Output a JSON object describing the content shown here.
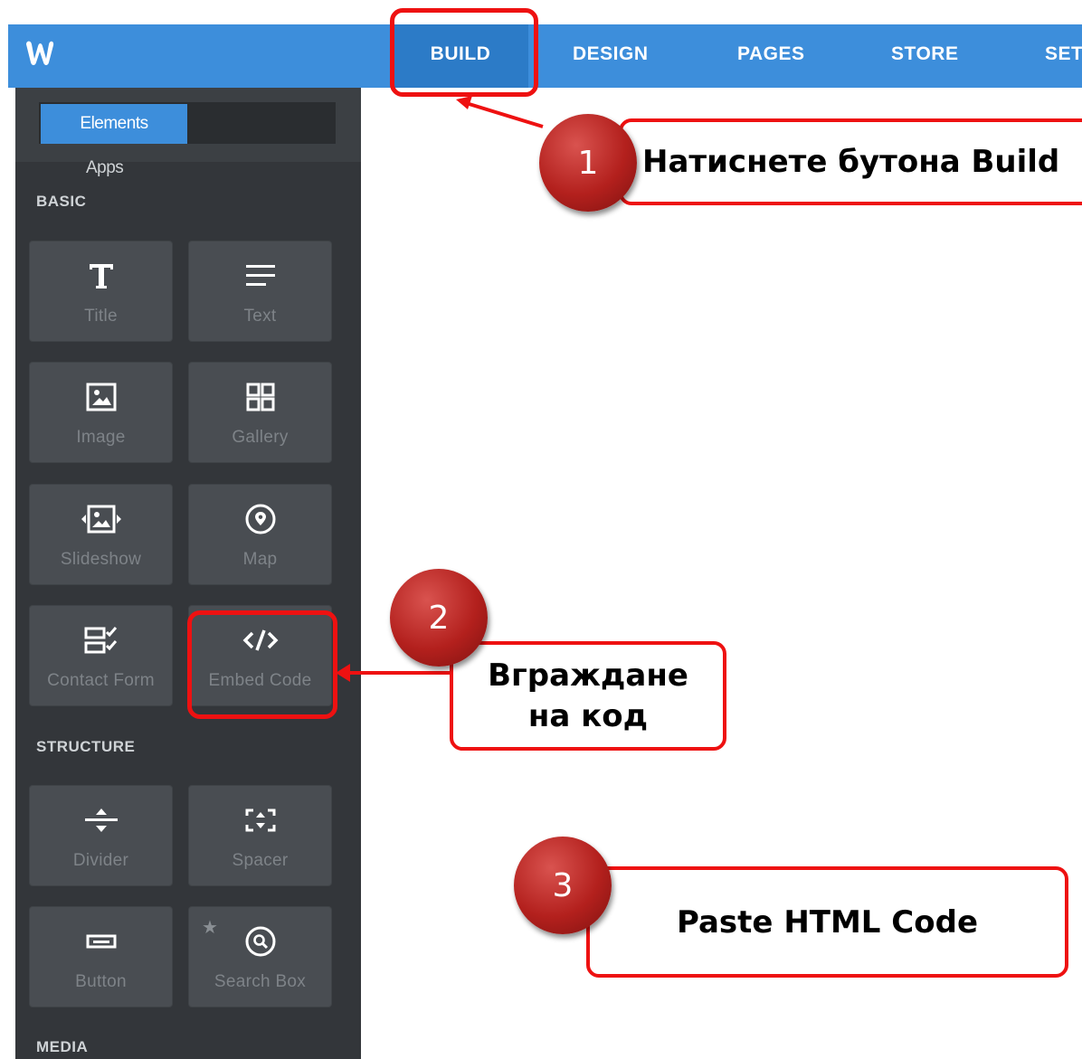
{
  "topbar": {
    "logo": "weebly-w-icon",
    "nav": [
      {
        "label": "BUILD",
        "active": true
      },
      {
        "label": "DESIGN",
        "active": false
      },
      {
        "label": "PAGES",
        "active": false
      },
      {
        "label": "STORE",
        "active": false
      },
      {
        "label": "SET",
        "active": false
      }
    ]
  },
  "sidebar": {
    "tabs": {
      "elements": "Elements",
      "apps": "Apps"
    },
    "sections": {
      "basic": "BASIC",
      "structure": "STRUCTURE",
      "media": "MEDIA"
    },
    "basic_tiles": [
      {
        "label": "Title",
        "icon": "title-icon"
      },
      {
        "label": "Text",
        "icon": "text-icon"
      },
      {
        "label": "Image",
        "icon": "image-icon"
      },
      {
        "label": "Gallery",
        "icon": "gallery-icon"
      },
      {
        "label": "Slideshow",
        "icon": "slideshow-icon"
      },
      {
        "label": "Map",
        "icon": "map-pin-icon"
      },
      {
        "label": "Contact Form",
        "icon": "contact-form-icon"
      },
      {
        "label": "Embed Code",
        "icon": "embed-code-icon"
      }
    ],
    "structure_tiles": [
      {
        "label": "Divider",
        "icon": "divider-icon"
      },
      {
        "label": "Spacer",
        "icon": "spacer-icon"
      },
      {
        "label": "Button",
        "icon": "button-icon"
      },
      {
        "label": "Search Box",
        "icon": "search-icon",
        "starred": true
      }
    ]
  },
  "annotations": {
    "step1": {
      "number": "1",
      "text": "Натиснете бутона Build"
    },
    "step2": {
      "number": "2",
      "line1": "Вграждане",
      "line2": "на код"
    },
    "step3": {
      "number": "3",
      "text": "Paste HTML Code"
    }
  },
  "colors": {
    "topbar": "#3d8edb",
    "sidebar": "#33363a",
    "tile": "#494d52",
    "highlight": "#ee1111"
  }
}
